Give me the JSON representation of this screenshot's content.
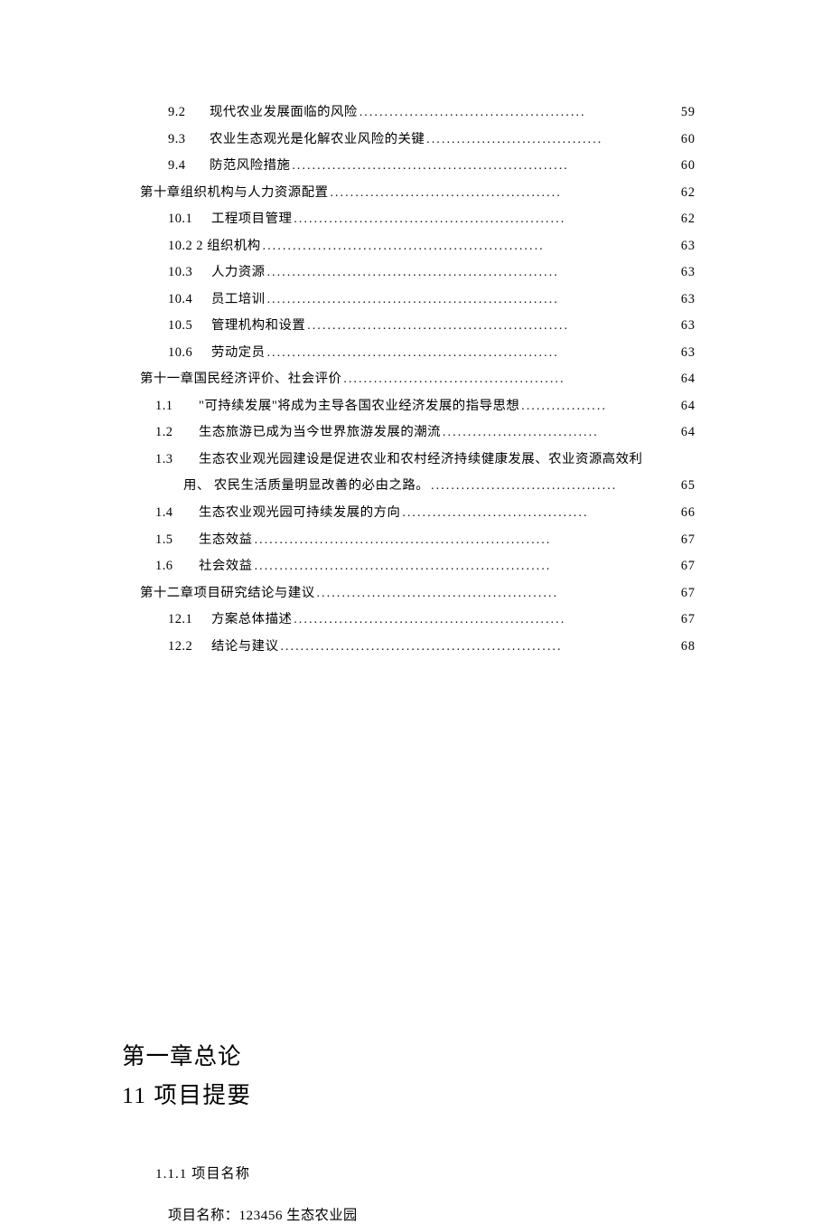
{
  "toc": [
    {
      "indent": 1,
      "num": "9.2",
      "title": "现代农业发展面临的风险",
      "page": "59",
      "leader": "............................................."
    },
    {
      "indent": 1,
      "num": "9.3",
      "title": "农业生态观光是化解农业风险的关键",
      "page": "60",
      "leader": "..................................."
    },
    {
      "indent": 1,
      "num": "9.4",
      "title": "防范风险措施",
      "page": "60",
      "leader": "......................................................."
    },
    {
      "indent": 0,
      "num": "",
      "title": "第十章组织机构与人力资源配置",
      "page": "62",
      "leader": ".............................................."
    },
    {
      "indent": 1,
      "num": "10.1",
      "title": "工程项目管理",
      "page": "62",
      "leader": "......................................................"
    },
    {
      "indent": 1,
      "num": "",
      "title": "10.2 2 组织机构",
      "page": "63",
      "leader": "........................................................"
    },
    {
      "indent": 1,
      "num": "10.3",
      "title": "人力资源",
      "page": "63",
      "leader": ".........................................................."
    },
    {
      "indent": 1,
      "num": "10.4",
      "title": "员工培训",
      "page": "63",
      "leader": ".........................................................."
    },
    {
      "indent": 1,
      "num": "10.5",
      "title": "管理机构和设置",
      "page": "63",
      "leader": "...................................................."
    },
    {
      "indent": 1,
      "num": "10.6",
      "title": "劳动定员",
      "page": "63",
      "leader": ".........................................................."
    },
    {
      "indent": 0,
      "num": "",
      "title": "第十一章国民经济评价、社会评价",
      "page": "64",
      "leader": "............................................"
    },
    {
      "indent": 2,
      "num": "1.1",
      "title": "\"可持续发展\"将成为主导各国农业经济发展的指导思想",
      "page": "64",
      "leader": "................."
    },
    {
      "indent": 2,
      "num": "1.2",
      "title": "生态旅游已成为当今世界旅游发展的潮流",
      "page": "64",
      "leader": "..............................."
    },
    {
      "indent": 2,
      "num": "1.3",
      "title": "生态农业观光园建设是促进农业和农村经济持续健康发展、农业资源高效利",
      "page": "",
      "leader": ""
    },
    {
      "indent": 2,
      "special": "wrap",
      "line": "用、 农民生活质量明显改善的必由之路。",
      "page": "65",
      "leader": " .....................................",
      "num": "",
      "title": ""
    },
    {
      "indent": 2,
      "num": "1.4",
      "title": "生态农业观光园可持续发展的方向",
      "page": "66",
      "leader": "....................................."
    },
    {
      "indent": 2,
      "num": "1.5",
      "title": "生态效益",
      "page": "67",
      "leader": "..........................................................."
    },
    {
      "indent": 2,
      "num": "1.6",
      "title": "社会效益",
      "page": "67",
      "leader": "..........................................................."
    },
    {
      "indent": 0,
      "num": "",
      "title": "第十二章项目研究结论与建议",
      "page": "67",
      "leader": "................................................"
    },
    {
      "indent": 1,
      "num": "12.1",
      "title": "方案总体描述",
      "page": "67",
      "leader": "......................................................"
    },
    {
      "indent": 1,
      "num": "12.2",
      "title": "结论与建议",
      "page": "68",
      "leader": "........................................................"
    }
  ],
  "body": {
    "chapter": "第一章总论",
    "section": "11 项目提要",
    "sub111": "1.1.1  项目名称",
    "project_name": "项目名称：123456 生态农业园"
  }
}
